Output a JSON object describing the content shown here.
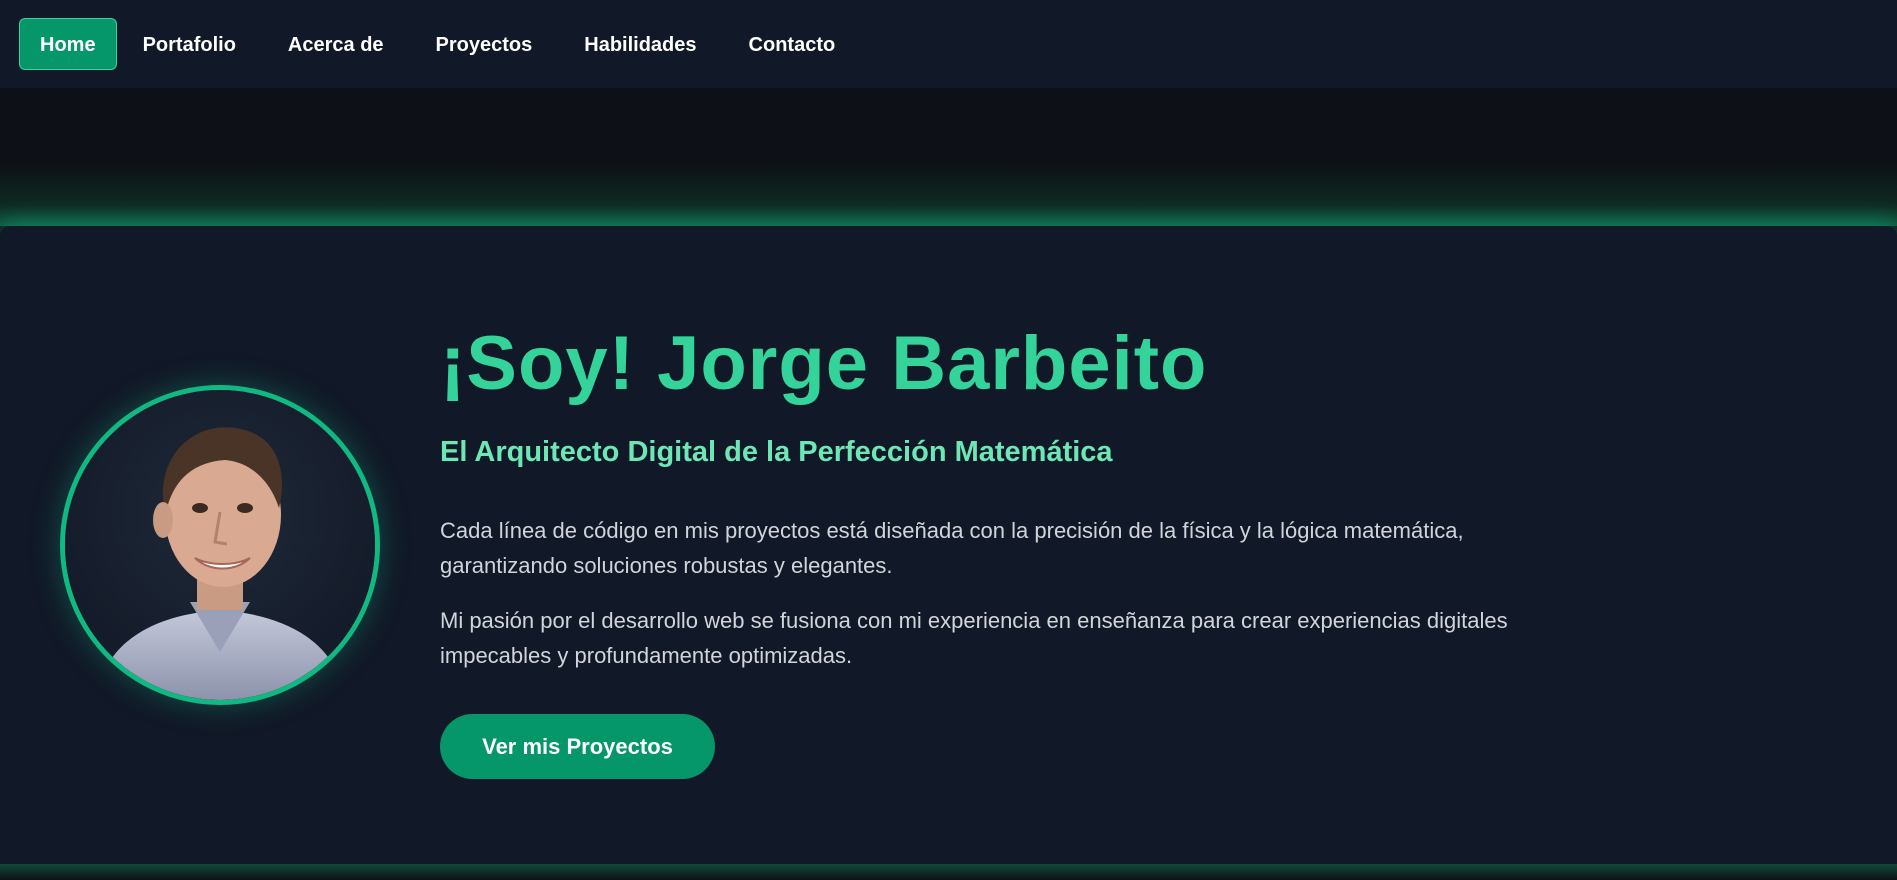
{
  "nav": {
    "items": [
      {
        "label": "Home",
        "active": true
      },
      {
        "label": "Portafolio",
        "active": false
      },
      {
        "label": "Acerca de",
        "active": false
      },
      {
        "label": "Proyectos",
        "active": false
      },
      {
        "label": "Habilidades",
        "active": false
      },
      {
        "label": "Contacto",
        "active": false
      }
    ]
  },
  "hero": {
    "title": "¡Soy! Jorge Barbeito",
    "subtitle": "El Arquitecto Digital de la Perfección Matemática",
    "paragraph1": "Cada línea de código en mis proyectos está diseñada con la precisión de la física y la lógica matemática, garantizando soluciones robustas y elegantes.",
    "paragraph2": "Mi pasión por el desarrollo web se fusiona con mi experiencia en enseñanza para crear experiencias digitales impecables y profundamente optimizadas.",
    "cta_label": "Ver mis Proyectos"
  },
  "colors": {
    "accent": "#10b981",
    "accent_dark": "#059669",
    "title": "#34d399",
    "subtitle": "#6ee7b7",
    "background": "#111827",
    "page_background": "#0d1117",
    "text": "#d1d5db"
  },
  "icons": {
    "avatar": "profile-photo"
  }
}
